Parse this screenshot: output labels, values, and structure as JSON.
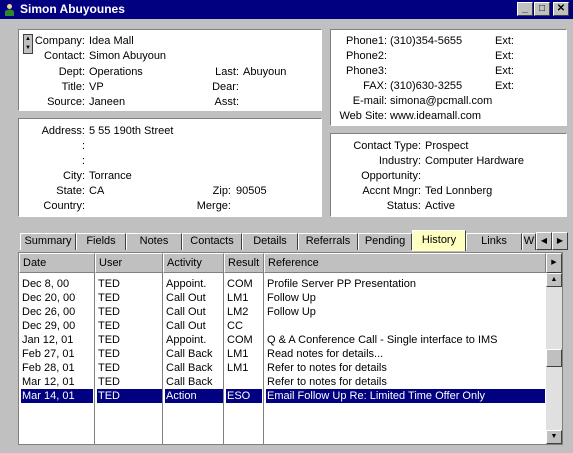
{
  "window": {
    "title": "Simon Abuyounes"
  },
  "contact": {
    "company_label": "Company:",
    "company": "Idea Mall",
    "contact_label": "Contact:",
    "contact": "Simon Abuyoun",
    "dept_label": "Dept:",
    "dept": "Operations",
    "last_label": "Last:",
    "last": "Abuyoun",
    "title_label": "Title:",
    "title": "VP",
    "dear_label": "Dear:",
    "dear": "",
    "source_label": "Source:",
    "source": "Janeen",
    "asst_label": "Asst:",
    "asst": ""
  },
  "phones": {
    "phone1_label": "Phone1:",
    "phone1": "(310)354-5655",
    "phone2_label": "Phone2:",
    "phone2": "",
    "phone3_label": "Phone3:",
    "phone3": "",
    "fax_label": "FAX:",
    "fax": "(310)630-3255",
    "ext_label": "Ext:",
    "email_label": "E-mail:",
    "email": "simona@pcmall.com",
    "website_label": "Web Site:",
    "website": "www.ideamall.com"
  },
  "address": {
    "address_label": "Address:",
    "address": "5 55 190th Street",
    "line2_label": ":",
    "line3_label": ":",
    "city_label": "City:",
    "city": "Torrance",
    "state_label": "State:",
    "state": "CA",
    "zip_label": "Zip:",
    "zip": "90505",
    "country_label": "Country:",
    "country": "",
    "merge_label": "Merge:",
    "merge": ""
  },
  "classification": {
    "contact_type_label": "Contact Type:",
    "contact_type": "Prospect",
    "industry_label": "Industry:",
    "industry": "Computer Hardware",
    "opportunity_label": "Opportunity:",
    "opportunity": "",
    "manager_label": "Accnt Mngr:",
    "manager": "Ted Lonnberg",
    "status_label": "Status:",
    "status": "Active"
  },
  "tabs": [
    "Summary",
    "Fields",
    "Notes",
    "Contacts",
    "Details",
    "Referrals",
    "Pending",
    "History",
    "Links",
    "W"
  ],
  "active_tab": "History",
  "history": {
    "columns": [
      "Date",
      "User",
      "Activity",
      "Result",
      "Reference"
    ],
    "rows": [
      [
        "Dec 8, 00",
        "TED",
        "Appoint.",
        "COM",
        "Profile Server PP Presentation"
      ],
      [
        "Dec 20, 00",
        "TED",
        "Call Out",
        "LM1",
        "Follow Up"
      ],
      [
        "Dec 26, 00",
        "TED",
        "Call Out",
        "LM2",
        "Follow Up"
      ],
      [
        "Dec 29, 00",
        "TED",
        "Call Out",
        "CC",
        ""
      ],
      [
        "Jan 12, 01",
        "TED",
        "Appoint.",
        "COM",
        "Q & A Conference Call - Single interface to IMS"
      ],
      [
        "Feb 27, 01",
        "TED",
        "Call Back",
        "LM1",
        "Read notes for details..."
      ],
      [
        "Feb 28, 01",
        "TED",
        "Call Back",
        "LM1",
        "Refer to notes for details"
      ],
      [
        "Mar 12, 01",
        "TED",
        "Call Back",
        "",
        "Refer to notes for details"
      ],
      [
        "Mar 14, 01",
        "TED",
        "Action",
        "ESO",
        "Email Follow Up Re: Limited Time Offer Only"
      ]
    ],
    "selected_row": 8
  },
  "colors": {
    "titlebar": "#000080",
    "selection": "#000080",
    "active_tab": "#ffffc0",
    "face": "#c0c0c0"
  },
  "icons": [
    "person-icon",
    "minimize-icon",
    "maximize-icon",
    "close-icon",
    "spin-up-icon",
    "spin-down-icon",
    "tab-left-icon",
    "tab-right-icon",
    "scroll-up-icon",
    "scroll-down-icon",
    "column-menu-icon"
  ]
}
